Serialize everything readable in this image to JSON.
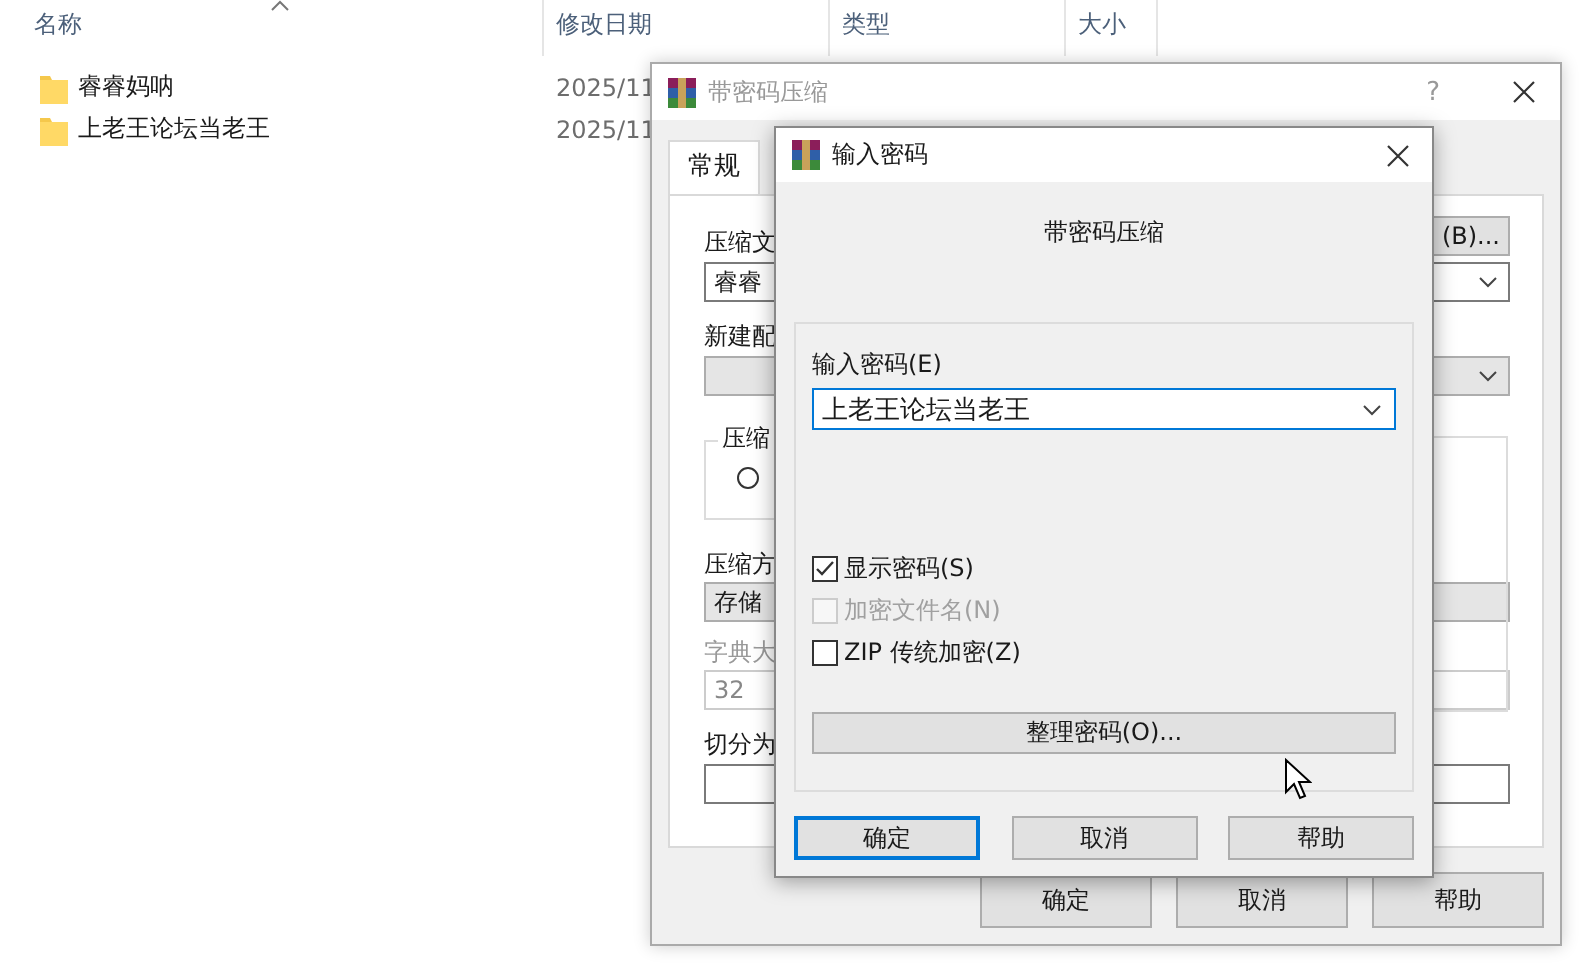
{
  "explorer": {
    "columns": [
      "名称",
      "修改日期",
      "类型",
      "大小"
    ],
    "rows": [
      {
        "name": "睿睿妈呐",
        "modified": "2025/11"
      },
      {
        "name": "上老王论坛当老王",
        "modified": "2025/11"
      }
    ]
  },
  "archive_dialog": {
    "title": "带密码压缩",
    "help": "?",
    "tabs": [
      {
        "label": "常规",
        "selected": true
      }
    ],
    "archive_name_label": "压缩文",
    "browse_button": "(B)...",
    "archive_name": "睿睿",
    "profile_label": "新建配",
    "format_group": "压缩",
    "format_radio": {
      "selected": false
    },
    "method_label": "压缩方",
    "method": "存储",
    "dictionary_label": "字典大",
    "dictionary": "32",
    "split_label": "切分为",
    "buttons": [
      {
        "label": "确定"
      },
      {
        "label": "取消"
      },
      {
        "label": "帮助"
      }
    ]
  },
  "password_dialog": {
    "title": "输入密码",
    "heading": "带密码压缩",
    "password_label": "输入密码(E)",
    "password": "上老王论坛当老王",
    "options": [
      {
        "label": "显示密码(S)",
        "checked": true,
        "disabled": false
      },
      {
        "label": "加密文件名(N)",
        "checked": false,
        "disabled": true
      },
      {
        "label": "ZIP 传统加密(Z)",
        "checked": false,
        "disabled": false
      }
    ],
    "organize_button": "整理密码(O)...",
    "buttons": [
      {
        "label": "确定",
        "default": true
      },
      {
        "label": "取消",
        "default": false
      },
      {
        "label": "帮助",
        "default": false
      }
    ]
  }
}
